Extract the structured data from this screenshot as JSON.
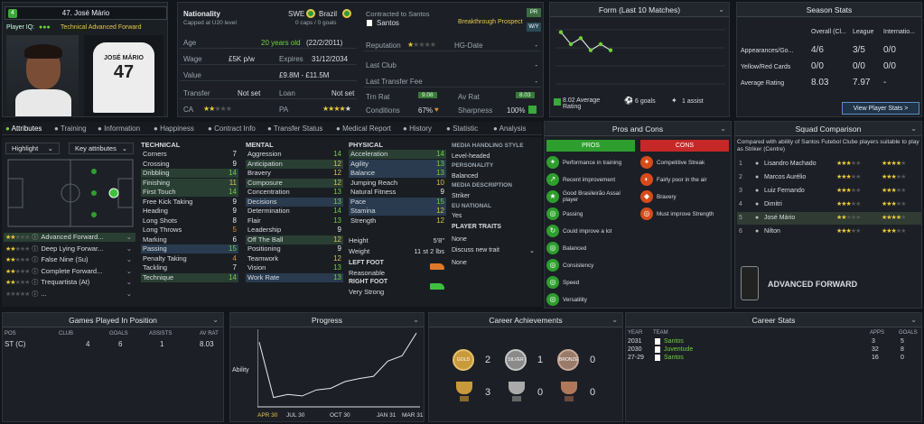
{
  "player": {
    "number_badge": "4",
    "name": "47. José Mário",
    "player_iq_label": "Player IQ:",
    "role": "Technical Advanced Forward",
    "shirt_name": "JOSÉ MÁRIO",
    "shirt_number": "47"
  },
  "info": {
    "nationality_label": "Nationality",
    "nationality_sub": "Capped at U20 level",
    "nation_code": "SWE",
    "nation_name": "Brazil",
    "caps": "0 caps / 0 goals",
    "contract_label": "Contracted to Santos",
    "contract_club": "Santos",
    "prospect": "Breakthrough Prospect",
    "pr_badge": "PR",
    "wp_badge": "W/Y",
    "age_label": "Age",
    "age_val": "20 years old",
    "dob": "(22/2/2011)",
    "wage_label": "Wage",
    "wage_val": "£5K p/w",
    "expires_label": "Expires",
    "expires_val": "31/12/2034",
    "value_label": "Value",
    "value_val": "£9.8M - £11.5M",
    "transfer_label": "Transfer",
    "transfer_val": "Not set",
    "loan_label": "Loan",
    "loan_val": "Not set",
    "ca_label": "CA",
    "pa_label": "PA",
    "reputation_label": "Reputation",
    "hgdate_label": "HG-Date",
    "hgdate_val": "-",
    "lastclub_label": "Last Club",
    "lastclub_val": "-",
    "lastfee_label": "Last Transfer Fee",
    "lastfee_val": "-",
    "trnrat_label": "Trn Rat",
    "trnrat_val": "9.08",
    "avrat_label": "Av Rat",
    "avrat_val": "8.03",
    "conditions_label": "Conditions",
    "conditions_val": "67%",
    "sharpness_label": "Sharpness",
    "sharpness_val": "100%"
  },
  "form": {
    "title": "Form (Last 10 Matches)",
    "avg_rating": "8.02 Average Rating",
    "goals": "6 goals",
    "assists": "1 assist"
  },
  "season": {
    "title": "Season Stats",
    "col1": "Overall (Cl...",
    "col2": "League",
    "col3": "Internatio...",
    "row1_label": "Appearances/Go...",
    "row1": [
      "4/6",
      "3/5",
      "0/0"
    ],
    "row2_label": "Yellow/Red Cards",
    "row2": [
      "0/0",
      "0/0",
      "0/0"
    ],
    "row3_label": "Average Rating",
    "row3": [
      "8.03",
      "7.97",
      "-"
    ],
    "button": "View Player Stats >"
  },
  "tabs": [
    "Attributes",
    "Training",
    "Information",
    "Happiness",
    "Contract Info",
    "Transfer Status",
    "Medical Report",
    "History",
    "Statistic",
    "Analysis"
  ],
  "attr_panel": {
    "highlight": "Highlight",
    "key_attributes": "Key attributes",
    "technical_title": "TECHNICAL",
    "mental_title": "MENTAL",
    "physical_title": "PHYSICAL",
    "technical": [
      {
        "name": "Corners",
        "value": "7"
      },
      {
        "name": "Crossing",
        "value": "9"
      },
      {
        "name": "Dribbling",
        "value": "14"
      },
      {
        "name": "Finishing",
        "value": "11"
      },
      {
        "name": "First Touch",
        "value": "14"
      },
      {
        "name": "Free Kick Taking",
        "value": "9"
      },
      {
        "name": "Heading",
        "value": "9"
      },
      {
        "name": "Long Shots",
        "value": "8"
      },
      {
        "name": "Long Throws",
        "value": "5"
      },
      {
        "name": "Marking",
        "value": "6"
      },
      {
        "name": "Passing",
        "value": "15"
      },
      {
        "name": "Penalty Taking",
        "value": "4"
      },
      {
        "name": "Tackling",
        "value": "7"
      },
      {
        "name": "Technique",
        "value": "14"
      }
    ],
    "mental": [
      {
        "name": "Aggression",
        "value": "14"
      },
      {
        "name": "Anticipation",
        "value": "12"
      },
      {
        "name": "Bravery",
        "value": "12"
      },
      {
        "name": "Composure",
        "value": "12"
      },
      {
        "name": "Concentration",
        "value": "13"
      },
      {
        "name": "Decisions",
        "value": "13"
      },
      {
        "name": "Determination",
        "value": "14"
      },
      {
        "name": "Flair",
        "value": "13"
      },
      {
        "name": "Leadership",
        "value": "9"
      },
      {
        "name": "Off The Ball",
        "value": "12"
      },
      {
        "name": "Positioning",
        "value": "9"
      },
      {
        "name": "Teamwork",
        "value": "12"
      },
      {
        "name": "Vision",
        "value": "13"
      },
      {
        "name": "Work Rate",
        "value": "13"
      }
    ],
    "physical": [
      {
        "name": "Acceleration",
        "value": "14"
      },
      {
        "name": "Agility",
        "value": "13"
      },
      {
        "name": "Balance",
        "value": "13"
      },
      {
        "name": "Jumping Reach",
        "value": "10"
      },
      {
        "name": "Natural Fitness",
        "value": "9"
      },
      {
        "name": "Pace",
        "value": "15"
      },
      {
        "name": "Stamina",
        "value": "12"
      },
      {
        "name": "Strength",
        "value": "12"
      }
    ],
    "height_label": "Height",
    "height_val": "5'8\"",
    "weight_label": "Weight",
    "weight_val": "11 st 2 lbs",
    "left_foot_label": "LEFT FOOT",
    "left_foot_val": "Reasonable",
    "right_foot_label": "RIGHT FOOT",
    "right_foot_val": "Very Strong",
    "media_style_label": "MEDIA HANDLING STYLE",
    "media_style_val": "Level-headed",
    "personality_label": "PERSONALITY",
    "personality_val": "Balanced",
    "media_desc_label": "MEDIA DESCRIPTION",
    "media_desc_val": "Striker",
    "eu_label": "EU NATIONAL",
    "eu_val": "Yes",
    "traits_label": "PLAYER TRAITS",
    "traits_val": "None",
    "discuss_label": "Discuss new trait",
    "discuss_val": "None"
  },
  "roles": [
    {
      "name": "Advanced Forward..."
    },
    {
      "name": "Deep Lying Forwar..."
    },
    {
      "name": "False Nine (Su)"
    },
    {
      "name": "Complete Forward..."
    },
    {
      "name": "Trequartista (At)"
    },
    {
      "name": "..."
    }
  ],
  "pros_cons": {
    "title": "Pros and Cons",
    "pros_label": "PROS",
    "cons_label": "CONS",
    "pros": [
      "Performance in training",
      "Recent improvement",
      "Good Brasileirão Assaí player",
      "Passing",
      "Could improve a lot",
      "Balanced",
      "Consistency",
      "Speed",
      "Versatility"
    ],
    "cons": [
      "Competitive Streak",
      "Fairly poor in the air",
      "Bravery",
      "Must improve Strength"
    ]
  },
  "squad": {
    "title": "Squad Comparison",
    "desc": "Compared with ability of Santos Futebol Clube players suitable to play as Striker (Centre)",
    "players": [
      {
        "rank": "1",
        "name": "Lisandro Machado"
      },
      {
        "rank": "2",
        "name": "Marcos Aurélio"
      },
      {
        "rank": "3",
        "name": "Luiz Fernando"
      },
      {
        "rank": "4",
        "name": "Dimitri"
      },
      {
        "rank": "5",
        "name": "José Mário"
      },
      {
        "rank": "6",
        "name": "Nilton"
      }
    ],
    "role_title": "ADVANCED FORWARD"
  },
  "positions": {
    "title": "Games Played In Position",
    "cols": [
      "POS",
      "CLUB",
      "GOALS",
      "ASSISTS",
      "AV RAT"
    ],
    "row": [
      "ST (C)",
      "4",
      "6",
      "1",
      "8.03"
    ]
  },
  "progress": {
    "title": "Progress",
    "ylabel": "Ability",
    "xlabels": [
      "APR 30",
      "JUL 30",
      "OCT 30",
      "JAN 31",
      "MAR 31"
    ]
  },
  "achievements": {
    "title": "Career Achievements",
    "medals": [
      "2",
      "1",
      "0"
    ],
    "trophies": [
      "3",
      "0",
      "0"
    ],
    "gold": "GOLD",
    "silver": "SILVER",
    "bronze": "BRONZE"
  },
  "career": {
    "title": "Career Stats",
    "cols": [
      "YEAR",
      "TEAM",
      "APPS",
      "GOALS"
    ],
    "rows": [
      [
        "2031",
        "Santos",
        "3",
        "5"
      ],
      [
        "2030",
        "Juventude",
        "32",
        "8"
      ],
      [
        "27-29",
        "Santos",
        "16",
        "0"
      ]
    ]
  },
  "chart_data": {
    "type": "line",
    "x": [
      "APR 30",
      "JUL 30",
      "OCT 30",
      "JAN 31",
      "MAR 31"
    ],
    "ylabel": "Ability",
    "series": [
      {
        "values": [
          0.83,
          0.1,
          0.14,
          0.12,
          0.2,
          0.22,
          0.31,
          0.35,
          0.38,
          0.58,
          0.65,
          0.95
        ]
      }
    ]
  },
  "form_chart": {
    "type": "line",
    "values": [
      8.3,
      8.1,
      8.2,
      8.0,
      8.1,
      8.0
    ]
  },
  "colors": {
    "accent": "#6fcf3a",
    "pros": "#2e9e2e",
    "cons": "#c62828",
    "highlight_green": "#2a3f33",
    "highlight_blue": "#2a3b4f"
  }
}
